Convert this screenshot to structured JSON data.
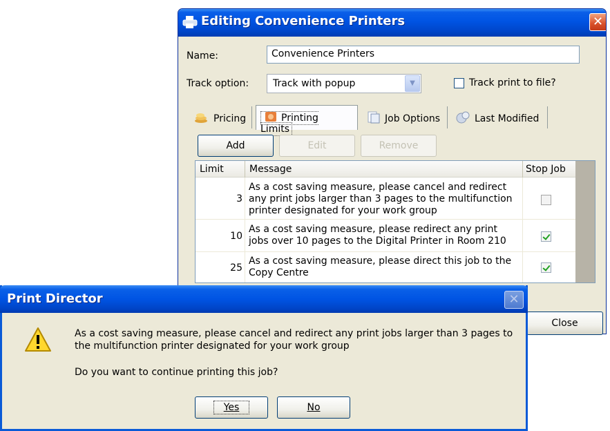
{
  "editor": {
    "title": "Editing Convenience Printers",
    "close_glyph": "✕",
    "name_label": "Name:",
    "name_value": "Convenience Printers",
    "track_label": "Track option:",
    "track_value": "Track with popup",
    "track_file_label": "Track print to file?",
    "tabs": [
      {
        "label": "Pricing",
        "icon": "pricing-icon"
      },
      {
        "label": "Printing Limits",
        "icon": "printing-limits-icon"
      },
      {
        "label": "Job Options",
        "icon": "job-options-icon"
      },
      {
        "label": "Last Modified",
        "icon": "last-modified-icon"
      }
    ],
    "buttons": {
      "add": "Add",
      "edit": "Edit",
      "remove": "Remove",
      "close": "Close"
    },
    "table": {
      "headers": {
        "limit": "Limit",
        "message": "Message",
        "stop": "Stop Job"
      },
      "rows": [
        {
          "limit": "3",
          "message": "As a cost saving measure, please cancel and redirect any print jobs larger than 3 pages to the multifunction printer designated for your work group",
          "stop": false
        },
        {
          "limit": "10",
          "message": "As a cost saving measure, please redirect any print jobs over 10 pages to the Digital Printer in Room 210",
          "stop": true
        },
        {
          "limit": "25",
          "message": "As a cost saving measure, please direct this job to the Copy Centre",
          "stop": true
        }
      ]
    }
  },
  "popup": {
    "title": "Print Director",
    "close_glyph": "✕",
    "message": "As a cost saving measure, please cancel and redirect any print jobs larger than 3 pages to the multifunction printer designated for your work group",
    "question": "Do you want to continue printing this job?",
    "yes": "Yes",
    "no": "No",
    "icon": "warning-icon"
  },
  "colors": {
    "title_bar": "#0054e3",
    "dialog_bg": "#ece9d8",
    "check_green": "#21a121"
  }
}
